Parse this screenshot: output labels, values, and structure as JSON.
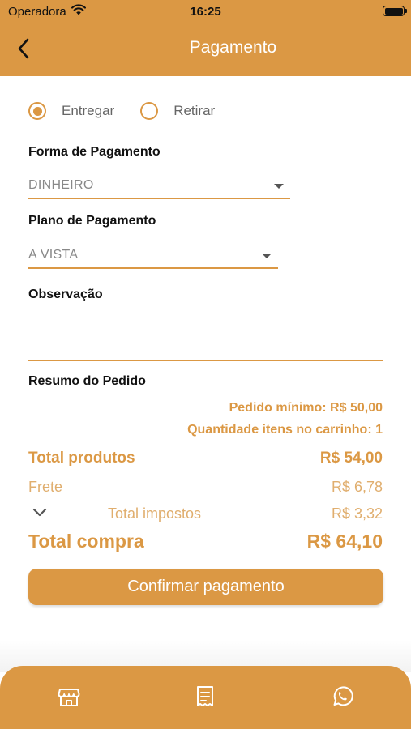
{
  "status_bar": {
    "carrier": "Operadora",
    "time": "16:25"
  },
  "header": {
    "title": "Pagamento"
  },
  "delivery": {
    "options": [
      {
        "label": "Entregar",
        "selected": true
      },
      {
        "label": "Retirar",
        "selected": false
      }
    ]
  },
  "payment_method": {
    "label": "Forma de Pagamento",
    "value": "DINHEIRO"
  },
  "payment_plan": {
    "label": "Plano de Pagamento",
    "value": "A VISTA"
  },
  "observation": {
    "label": "Observação",
    "value": ""
  },
  "summary": {
    "title": "Resumo do Pedido",
    "min_order": "Pedido mínimo: R$ 50,00",
    "cart_count": "Quantidade itens no carrinho: 1",
    "total_products_label": "Total produtos",
    "total_products_value": "R$ 54,00",
    "shipping_label": "Frete",
    "shipping_value": "R$ 6,78",
    "taxes_label": "Total impostos",
    "taxes_value": "R$ 3,32",
    "total_label": "Total compra",
    "total_value": "R$ 64,10"
  },
  "confirm_label": "Confirmar pagamento",
  "tabbar": {
    "icons": [
      "store-icon",
      "receipt-icon",
      "whatsapp-icon"
    ]
  },
  "colors": {
    "accent": "#DB9844",
    "accent_light": "#E0AE6E",
    "tabbar": "#DB9844"
  }
}
